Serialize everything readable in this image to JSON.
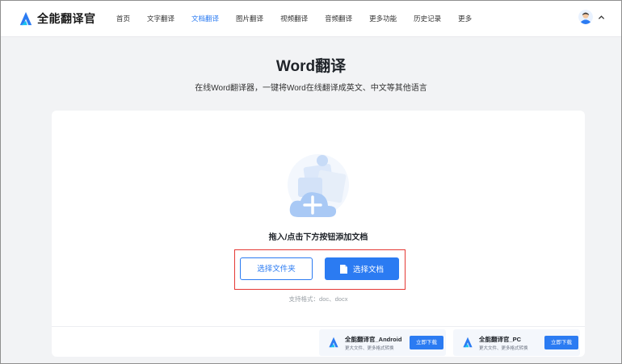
{
  "brand": {
    "name": "全能翻译官",
    "color": "#2b7bf2"
  },
  "nav": {
    "items": [
      {
        "label": "首页",
        "active": false
      },
      {
        "label": "文字翻译",
        "active": false
      },
      {
        "label": "文档翻译",
        "active": true
      },
      {
        "label": "图片翻译",
        "active": false
      },
      {
        "label": "视频翻译",
        "active": false
      },
      {
        "label": "音频翻译",
        "active": false
      },
      {
        "label": "更多功能",
        "active": false
      },
      {
        "label": "历史记录",
        "active": false
      },
      {
        "label": "更多",
        "active": false
      }
    ]
  },
  "header": {
    "avatar_icon": "user-avatar-icon",
    "menu_icon": "chevron-up-icon"
  },
  "page": {
    "title": "Word翻译",
    "subtitle": "在线Word翻译器，一键将Word在线翻译成英文、中文等其他语言"
  },
  "upload": {
    "illustration_icon": "cloud-upload-plus-icon",
    "drop_text": "拖入/点击下方按钮添加文档",
    "folder_button": "选择文件夹",
    "document_button": "选择文档",
    "document_icon": "document-icon",
    "formats": "支持格式：doc、docx",
    "highlight_color": "#e53935"
  },
  "downloads": [
    {
      "name": "全能翻译官_Android",
      "desc": "更大文件、更多格式转换",
      "button": "立即下载"
    },
    {
      "name": "全能翻译官_PC",
      "desc": "更大文件、更多格式转换",
      "button": "立即下载"
    }
  ]
}
